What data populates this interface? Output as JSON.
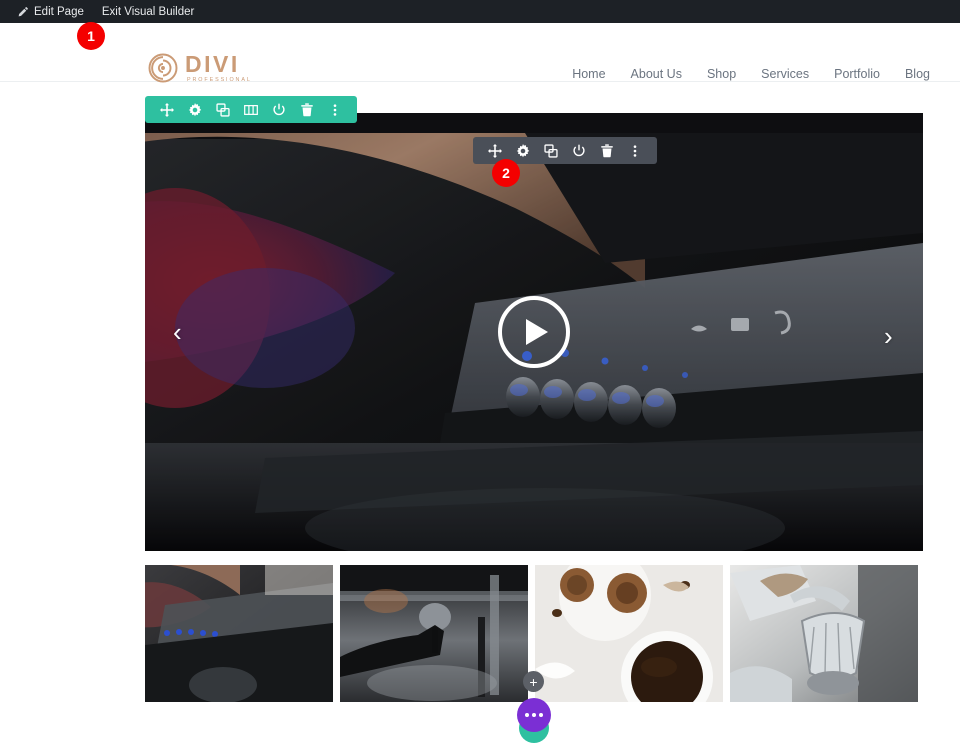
{
  "admin_bar": {
    "edit_page_label": "Edit Page",
    "exit_builder_label": "Exit Visual Builder",
    "pencil_icon": "pencil-icon",
    "bg_color": "#1d2126"
  },
  "header": {
    "logo": {
      "title": "DIVI",
      "subtitle": "PROFESSIONAL",
      "color": "#cb9b76",
      "icon": "divi-spiral-logo-icon"
    },
    "nav": [
      {
        "label": "Home"
      },
      {
        "label": "About Us"
      },
      {
        "label": "Shop"
      },
      {
        "label": "Services"
      },
      {
        "label": "Portfolio"
      },
      {
        "label": "Blog"
      }
    ],
    "nav_color": "#6b7480"
  },
  "section_toolbar": {
    "color": "#2ec0a0",
    "icons": [
      "move-icon",
      "gear-icon",
      "duplicate-icon",
      "columns-icon",
      "power-icon",
      "trash-icon",
      "more-vertical-icon"
    ]
  },
  "module_toolbar": {
    "color": "#4a4f58",
    "icons": [
      "move-icon",
      "gear-icon",
      "duplicate-icon",
      "power-icon",
      "trash-icon",
      "more-vertical-icon"
    ]
  },
  "badges": [
    {
      "label": "1",
      "color": "#f40000"
    },
    {
      "label": "2",
      "color": "#f40000"
    }
  ],
  "hero": {
    "prev_arrow": "‹",
    "next_arrow": "›",
    "play_icon": "play-button-icon",
    "alt": "espresso machine control panel with barista arm"
  },
  "gallery": {
    "thumbnails": [
      {
        "alt": "espresso machine control knobs"
      },
      {
        "alt": "portafilter pouring espresso"
      },
      {
        "alt": "pastries on plate with black coffee"
      },
      {
        "alt": "silver coffee filter basket"
      }
    ]
  },
  "floating": {
    "add_label": "+",
    "add_icon": "plus-icon",
    "menu_icon": "ellipsis-icon",
    "menu_color": "#7b2fd4",
    "teal_color": "#2ec0a0"
  }
}
